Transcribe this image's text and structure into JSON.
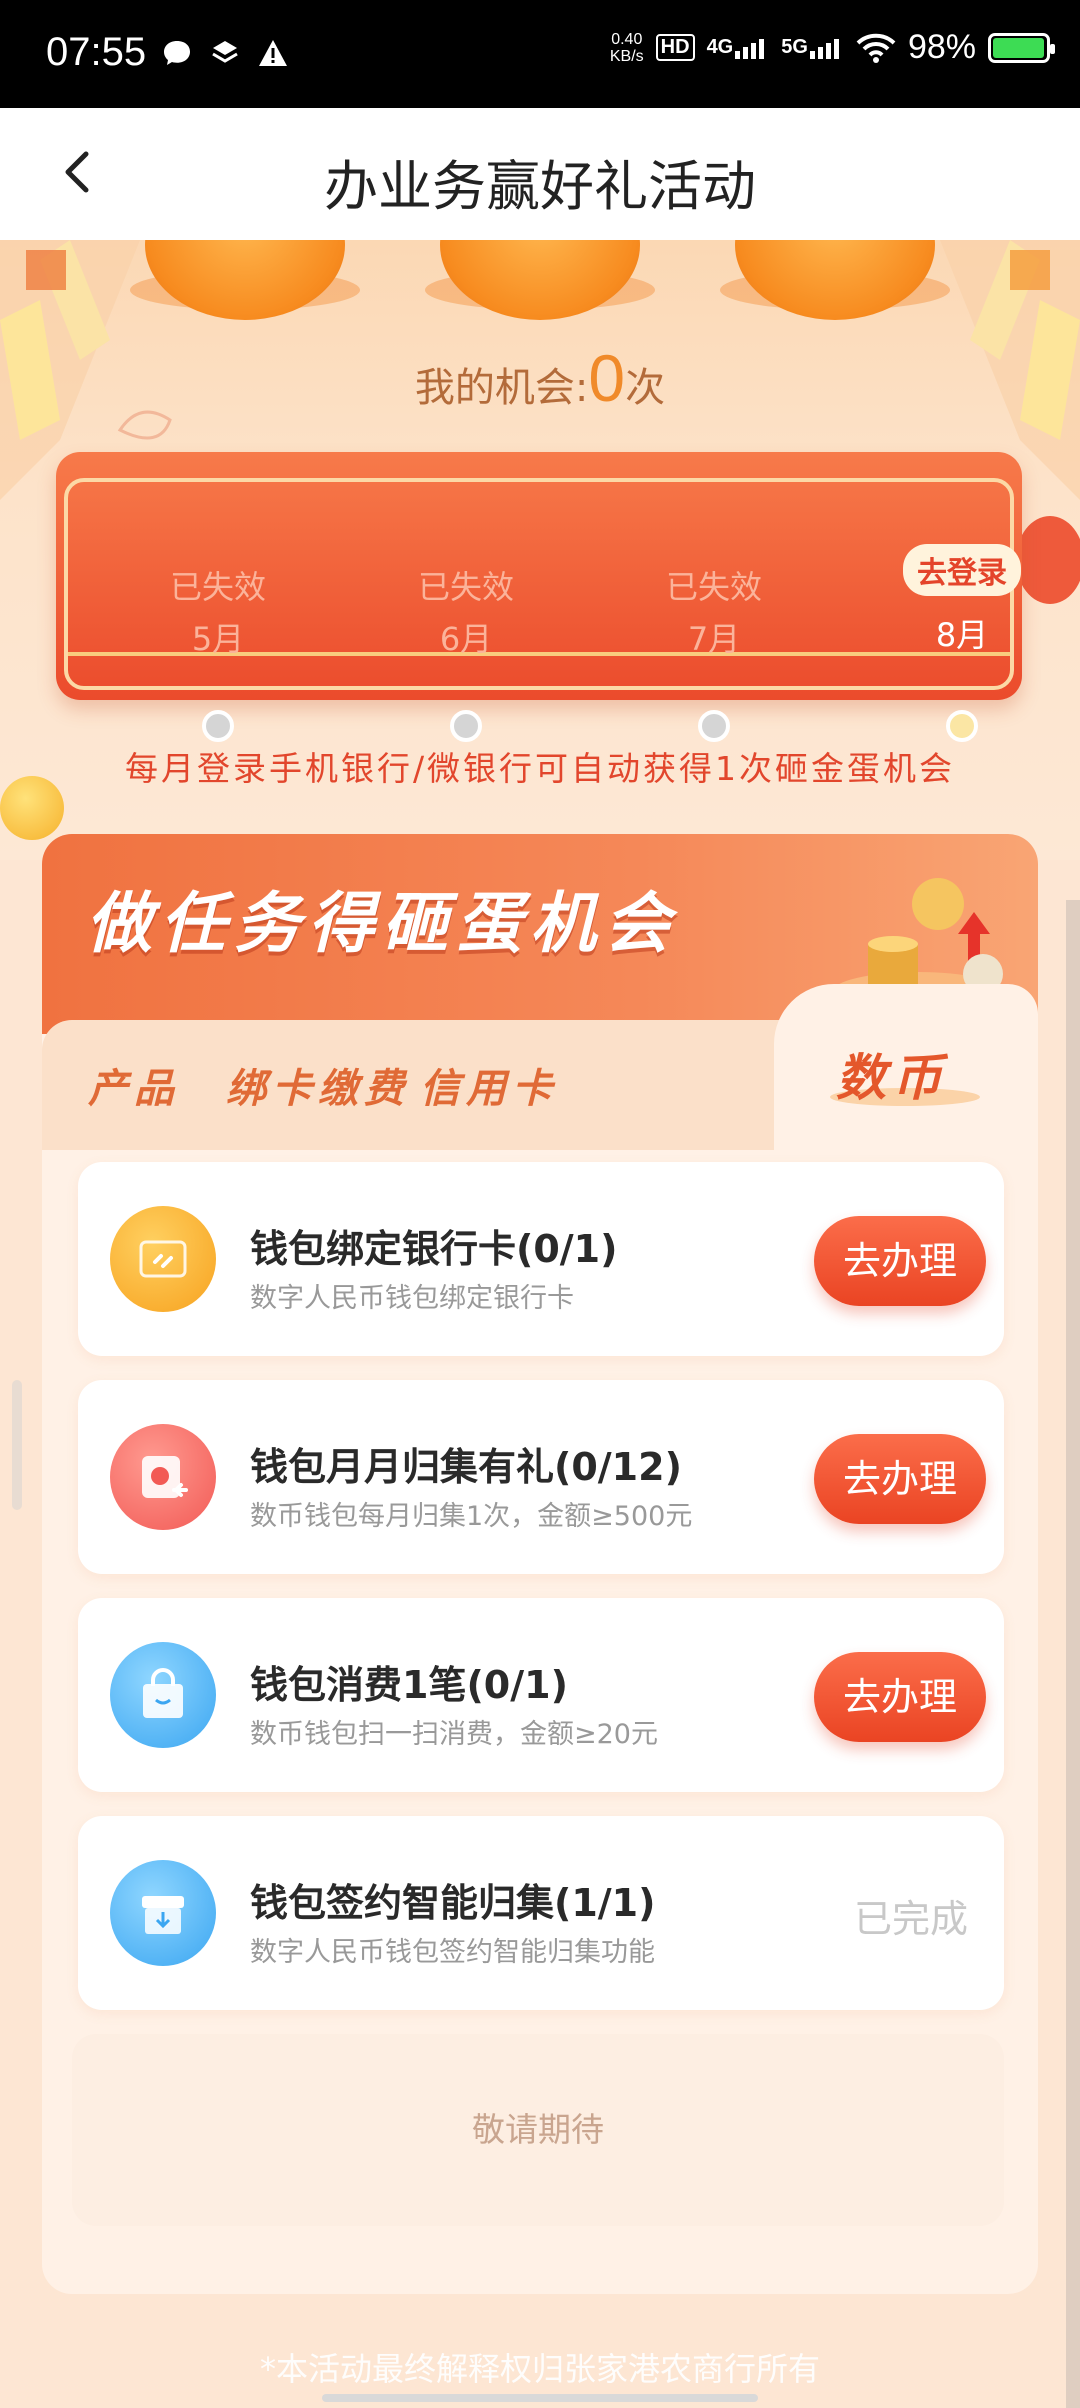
{
  "status_bar": {
    "time": "07:55",
    "net_speed_value": "0.40",
    "net_speed_unit": "KB/s",
    "hd_tag": "HD",
    "net1": "4G",
    "net2": "5G",
    "battery": "98%",
    "battery_level": 0.98,
    "icons": [
      "message-icon",
      "layers-icon",
      "warning-icon",
      "wifi-icon",
      "signal-icon",
      "battery-icon"
    ]
  },
  "header": {
    "title": "办业务赢好礼活动"
  },
  "hero": {
    "chances_label": "我的机会:",
    "chances_count": "0",
    "chances_unit": "次"
  },
  "months": [
    {
      "status": "已失效",
      "label": "5月"
    },
    {
      "status": "已失效",
      "label": "6月"
    },
    {
      "status": "已失效",
      "label": "7月"
    },
    {
      "status": "去登录",
      "label": "8月"
    }
  ],
  "auto_note": "每月登录手机银行/微银行可自动获得1次砸金蛋机会",
  "task_panel": {
    "title": "做任务得砸蛋机会",
    "tabs": [
      "产品",
      "绑卡缴费",
      "信用卡",
      "数币"
    ],
    "active_tab": "数币",
    "tasks": [
      {
        "title": "钱包绑定银行卡(0/1)",
        "subtitle": "数字人民币钱包绑定银行卡",
        "action": "去办理"
      },
      {
        "title": "钱包月月归集有礼(0/12)",
        "subtitle": "数币钱包每月归集1次，金额≥500元",
        "action": "去办理"
      },
      {
        "title": "钱包消费1笔(0/1)",
        "subtitle": "数币钱包扫一扫消费，金额≥20元",
        "action": "去办理"
      },
      {
        "title": "钱包签约智能归集(1/1)",
        "subtitle": "数字人民币钱包签约智能归集功能",
        "action": "已完成"
      }
    ],
    "stay_tuned": "敬请期待"
  },
  "footer_note": "*本活动最终解释权归张家港农商行所有",
  "colors": {
    "accent": "#ea4423",
    "orange": "#f08a2a",
    "bg": "#fde6d3"
  }
}
